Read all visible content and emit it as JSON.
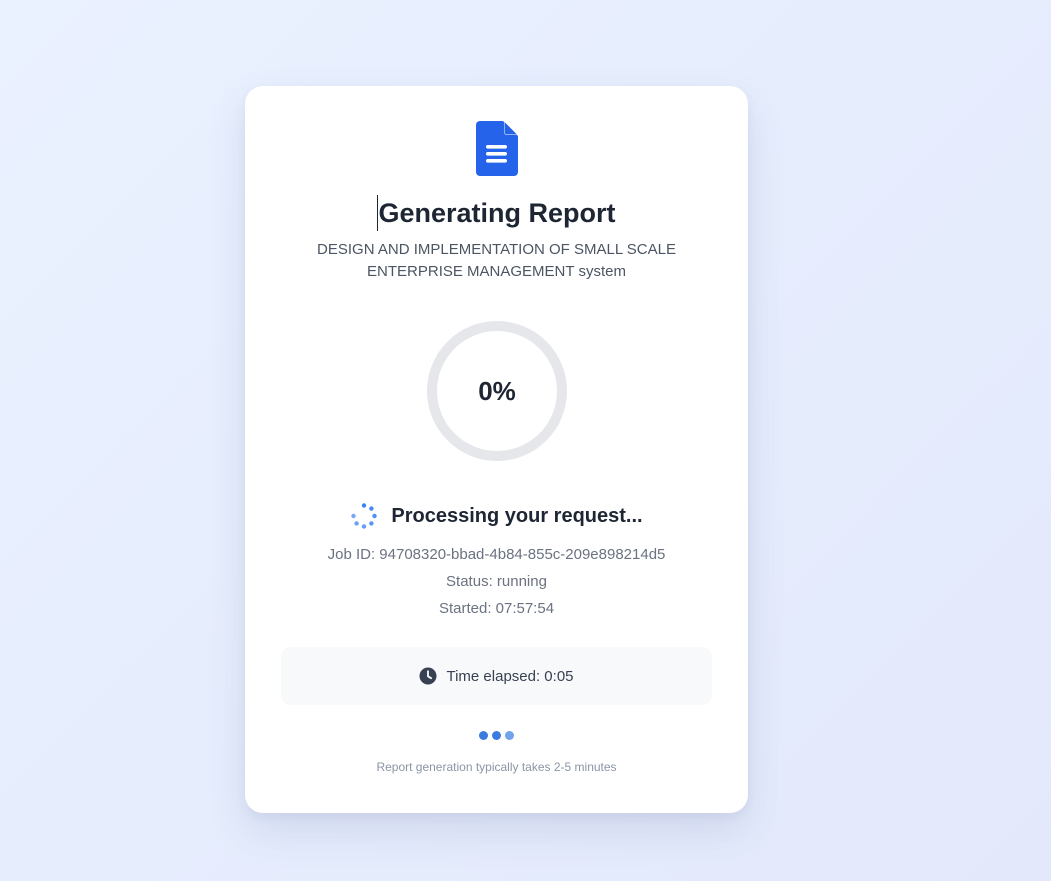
{
  "card": {
    "title": "Generating Report",
    "subtitle": "DESIGN AND IMPLEMENTATION OF SMALL SCALE ENTERPRISE MANAGEMENT system",
    "progress": {
      "label": "0%",
      "value": 0
    },
    "processing_label": "Processing your request...",
    "job_id": "Job ID: 94708320-bbad-4b84-855c-209e898214d5",
    "status": "Status: running",
    "started": "Started: 07:57:54",
    "time_elapsed": "Time elapsed: 0:05",
    "footnote": "Report generation typically takes 2-5 minutes"
  },
  "icons": {
    "document": "document-icon",
    "spinner": "spinner-icon",
    "clock": "clock-icon"
  },
  "colors": {
    "accent": "#2563eb",
    "ring_track": "#e5e7eb",
    "dot_1": "#3b7be0",
    "dot_2": "#3b7be0",
    "dot_3": "#6fa3ea"
  }
}
